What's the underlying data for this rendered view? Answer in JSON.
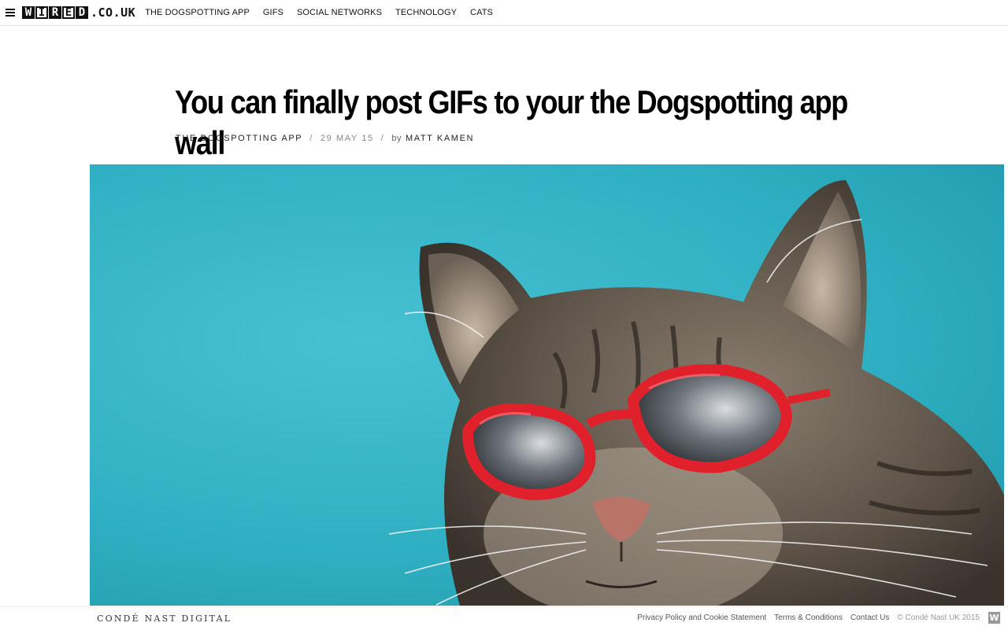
{
  "header": {
    "logo_letters": [
      "W",
      "I",
      "R",
      "E",
      "D"
    ],
    "logo_domain": ".CO.UK",
    "nav": [
      "THE DOGSPOTTING APP",
      "GIFS",
      "SOCIAL NETWORKS",
      "TECHNOLOGY",
      "CATS"
    ]
  },
  "article": {
    "title": "You can finally post GIFs to your the Dogspotting app wall",
    "category": "THE DOGSPOTTING APP",
    "date": "29 MAY 15",
    "by_label": "by",
    "author": "MATT KAMEN",
    "separator": "/"
  },
  "footer": {
    "publisher": "CONDÉ NAST DIGITAL",
    "links": [
      "Privacy Policy and Cookie Statement",
      "Terms & Conditions",
      "Contact Us"
    ],
    "copyright": "© Condé Nast UK 2015",
    "badge": "W"
  },
  "colors": {
    "background_teal": "#2fb0c2",
    "glasses_red": "#e0212b"
  }
}
